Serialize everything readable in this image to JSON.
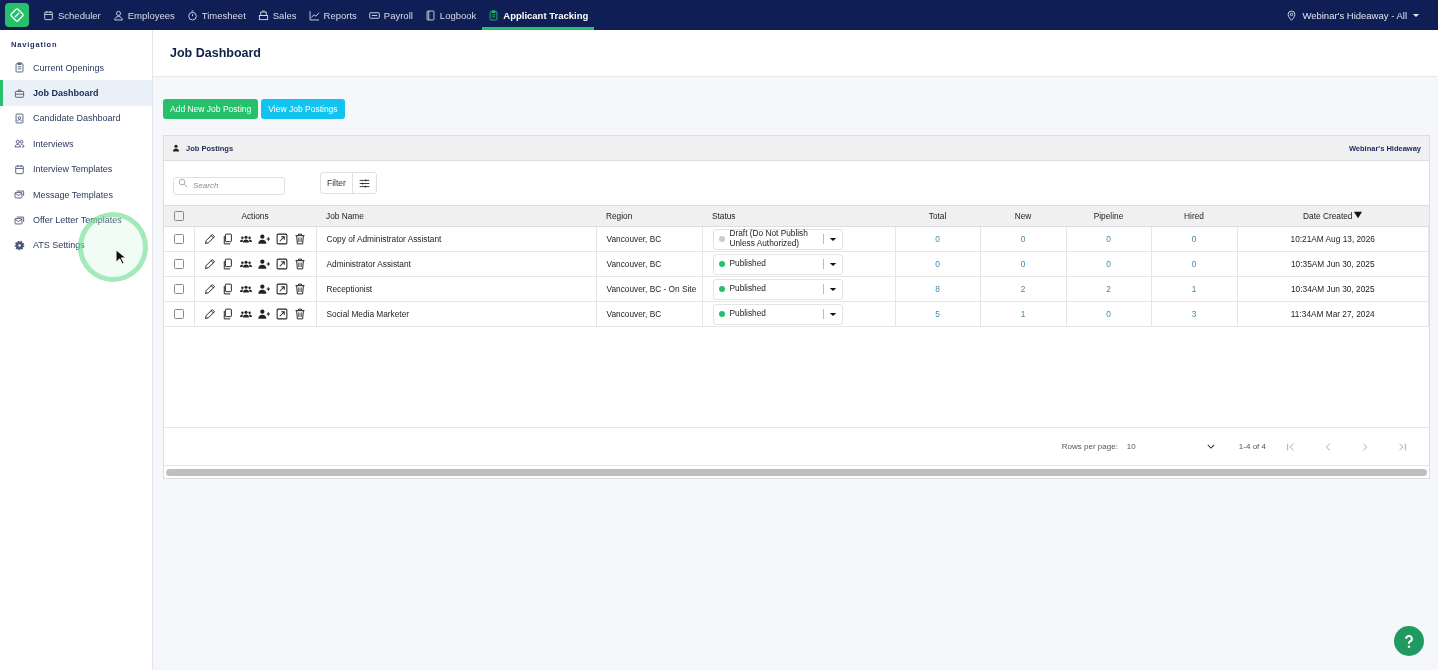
{
  "top_nav": [
    {
      "label": "Scheduler",
      "selected": false
    },
    {
      "label": "Employees",
      "selected": false
    },
    {
      "label": "Timesheet",
      "selected": false
    },
    {
      "label": "Sales",
      "selected": false
    },
    {
      "label": "Reports",
      "selected": false
    },
    {
      "label": "Payroll",
      "selected": false
    },
    {
      "label": "Logbook",
      "selected": false
    },
    {
      "label": "Applicant Tracking",
      "selected": true
    }
  ],
  "location": "Webinar's Hideaway - All",
  "sidebar": {
    "heading": "Navigation",
    "items": [
      {
        "label": "Current Openings",
        "selected": false
      },
      {
        "label": "Job Dashboard",
        "selected": true
      },
      {
        "label": "Candidate Dashboard",
        "selected": false
      },
      {
        "label": "Interviews",
        "selected": false
      },
      {
        "label": "Interview Templates",
        "selected": false
      },
      {
        "label": "Message Templates",
        "selected": false
      },
      {
        "label": "Offer Letter Templates",
        "selected": false
      },
      {
        "label": "ATS Settings",
        "selected": false
      }
    ]
  },
  "page_title": "Job Dashboard",
  "buttons": [
    {
      "label": "Add New Job Posting",
      "kind": "primary"
    },
    {
      "label": "View Job Postings",
      "kind": "info"
    }
  ],
  "panel": {
    "title": "Job Postings",
    "location": "Webinar's Hideaway",
    "search": {
      "placeholder": "Search"
    },
    "filter": "Filter",
    "table": {
      "all_checked": false,
      "columns": [
        "Actions",
        "Job Name",
        "Region",
        "Status",
        "Total",
        "New",
        "Pipeline",
        "Hired",
        "Date Created"
      ],
      "rows": [
        {
          "checked": false,
          "job_name": "Copy of Administrator Assistant",
          "region": "Vancouver, BC",
          "status": "Draft (Do Not Publish Unless Authorized)",
          "color": "#cccccc",
          "total": "0",
          "new": "0",
          "pipeline": "0",
          "hired": "0",
          "date_created": "10:21AM Aug 13, 2026"
        },
        {
          "checked": false,
          "job_name": "Administrator Assistant",
          "region": "Vancouver, BC",
          "status": "Published",
          "color": "#22c06b",
          "total": "0",
          "new": "0",
          "pipeline": "0",
          "hired": "0",
          "date_created": "10:35AM Jun 30, 2025"
        },
        {
          "checked": false,
          "job_name": "Receptionist",
          "region": "Vancouver, BC - On Site",
          "status": "Published",
          "color": "#22c06b",
          "total": "8",
          "new": "2",
          "pipeline": "2",
          "hired": "1",
          "date_created": "10:34AM Jun 30, 2025"
        },
        {
          "checked": false,
          "job_name": "Social Media Marketer",
          "region": "Vancouver, BC",
          "status": "Published",
          "color": "#22c06b",
          "total": "5",
          "new": "1",
          "pipeline": "0",
          "hired": "3",
          "date_created": "11:34AM Mar 27, 2024"
        }
      ]
    },
    "pagination": {
      "rows_per_page_label": "Rows per page:",
      "rows_per_page": "10",
      "range": "1-4 of 4"
    }
  }
}
